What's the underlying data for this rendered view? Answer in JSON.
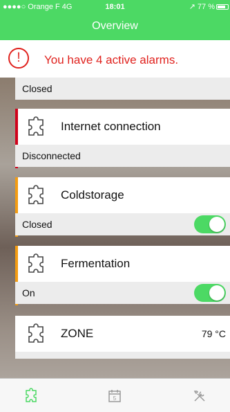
{
  "status_bar": {
    "carrier": "●●●●○ Orange F  4G",
    "time": "18:01",
    "right": "↗ 77 %"
  },
  "nav": {
    "title": "Overview"
  },
  "alarm": {
    "icon": "alert-circle-icon",
    "message": "You have 4 active alarms."
  },
  "cards": [
    {
      "status": "Closed",
      "status_color": "#d0021b"
    },
    {
      "name": "Internet connection",
      "status": "Disconnected",
      "status_color": "#d0021b"
    },
    {
      "name": "Coldstorage",
      "status": "Closed",
      "status_color": "#f39c12",
      "toggle_on": true
    },
    {
      "name": "Fermentation",
      "status": "On",
      "status_color": "#f39c12",
      "toggle_on": true
    },
    {
      "name": "ZONE",
      "value": "79 °C",
      "status": ""
    }
  ],
  "tabbar": {
    "items": [
      {
        "icon": "puzzle-icon",
        "active": true
      },
      {
        "icon": "calendar-icon",
        "calendar_day": "5",
        "active": false
      },
      {
        "icon": "tools-icon",
        "active": false
      }
    ]
  },
  "colors": {
    "accent": "#4cd964",
    "alarm_red": "#e0211d"
  }
}
